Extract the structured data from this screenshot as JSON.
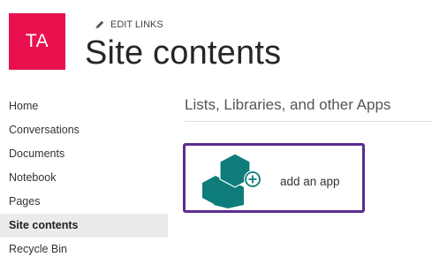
{
  "site": {
    "logo_initials": "TA",
    "logo_color": "#e8114e"
  },
  "header": {
    "edit_links_label": "EDIT LINKS",
    "edit_links_icon": "pencil-icon",
    "title": "Site contents"
  },
  "quick_launch": {
    "items": [
      {
        "label": "Home"
      },
      {
        "label": "Conversations"
      },
      {
        "label": "Documents"
      },
      {
        "label": "Notebook"
      },
      {
        "label": "Pages"
      },
      {
        "label": "Site contents",
        "selected": true
      },
      {
        "label": "Recycle Bin"
      }
    ],
    "selected_background": "#ebebeb"
  },
  "main": {
    "section_title": "Lists, Libraries, and other Apps",
    "add_app": {
      "label": "add an app",
      "icon": "add-app-hexagon-icon",
      "border_color": "#5c2d91",
      "icon_color": "#0e7c7b"
    }
  }
}
